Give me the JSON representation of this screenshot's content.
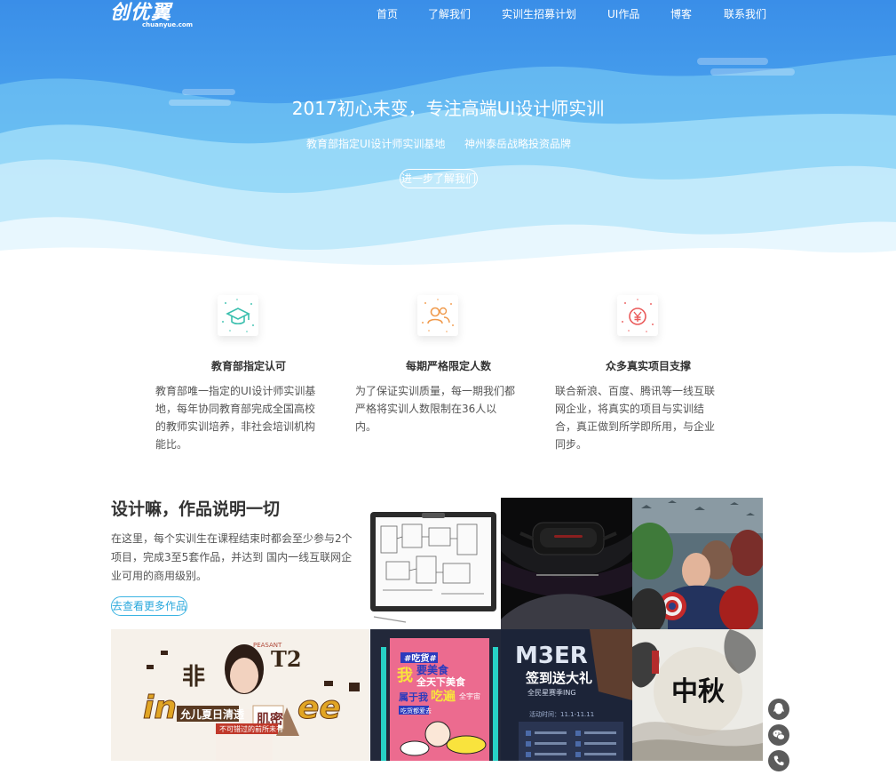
{
  "logo": {
    "main": "创优翼",
    "sub": "chuanyue.com"
  },
  "nav": [
    "首页",
    "了解我们",
    "实训生招募计划",
    "UI作品",
    "博客",
    "联系我们"
  ],
  "hero": {
    "title": "2017初心未变，专注高端UI设计师实训",
    "sub_left": "教育部指定UI设计师实训基地",
    "sub_right": "神州泰岳战略投资品牌",
    "button": "进一步了解我们"
  },
  "features": [
    {
      "icon": "graduation-cap-icon",
      "title": "教育部指定认可",
      "lines": [
        "教育部唯一指定的UI设计师实训基",
        "地，每年协同教育部完成全国高校",
        "的教师实训培养，非社会培训机构",
        "能比。"
      ]
    },
    {
      "icon": "users-icon",
      "title": "每期严格限定人数",
      "lines": [
        "为了保证实训质量，每一期我们都",
        "严格将实训人数限制在36人以内。"
      ]
    },
    {
      "icon": "yuan-coin-icon",
      "title": "众多真实项目支撑",
      "lines": [
        "联合新浪、百度、腾讯等一线互联",
        "网企业，将真实的项目与实训结",
        "合，真正做到所学即所用，与企业",
        "同步。"
      ]
    }
  ],
  "works": {
    "title": "设计嘛，作品说明一切",
    "desc_lines": [
      "在这里，每个实训生在课程结束时都会至少参与2个",
      "项目，完成3至5套作品，并达到 国内一线互联网企",
      "业可用的商用级别。"
    ],
    "button": "去查看更多作品"
  },
  "thumbs": {
    "drink": {
      "badge": "PEASANT",
      "word1": "in",
      "word2": "ee",
      "left_char": "非",
      "right_num": "T2",
      "slogan": "允儿夏日清透",
      "jelly": "肌密",
      "small": "不可错过的前所未有"
    },
    "food": {
      "tag": "#吃货#",
      "line1": "我",
      "line2": "要美食",
      "line3": "全天下美食",
      "line4": "属于我",
      "line5": "吃遍",
      "line6": "全宇宙",
      "ribbon": "吃货都爱去"
    },
    "m3er": {
      "big": "M3ER",
      "title": "签到送大礼",
      "sub": "全民星赛季ING",
      "date": "活动时间：11.1-11.11"
    },
    "mid": {
      "chars": "中秋"
    }
  },
  "colors": {
    "hero_top": "#3a8ee8",
    "hero_bottom": "#62c3f3",
    "accent": "#2aa8dc",
    "float_btn": "#5b5b5b"
  }
}
